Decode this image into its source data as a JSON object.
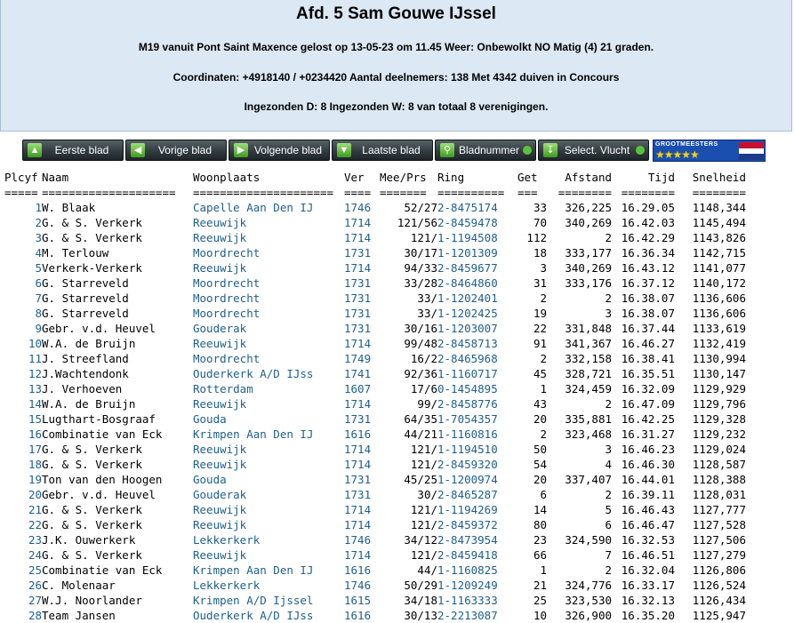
{
  "header": {
    "title": "Afd. 5 Sam Gouwe IJssel",
    "line1": "M19 vanuit Pont Saint Maxence gelost op 13-05-23 om 11.45 Weer: Onbewolkt NO Matig (4) 21 graden.",
    "line2": "Coordinaten: +4918140 / +0234420 Aantal deelnemers: 138 Met 4342 duiven in Concours",
    "line3": "Ingezonden D: 8 Ingezonden W: 8 van totaal 8 verenigingen."
  },
  "nav": {
    "first": "Eerste blad",
    "prev": "Vorige blad",
    "next": "Volgende blad",
    "last": "Laatste blad",
    "page": "Bladnummer",
    "select": "Select. Vlucht",
    "badge": "GROOTMEESTERS",
    "stars": "★★★★★",
    "icons": {
      "first": "up-arrow-icon",
      "prev": "left-arrow-icon",
      "next": "right-arrow-icon",
      "last": "down-arrow-icon",
      "page": "search-icon",
      "select": "download-icon"
    }
  },
  "table": {
    "headers": [
      "Plcyf",
      "Naam",
      "Woonplaats",
      "Ver",
      "Mee/Prs",
      "Ring",
      "Get",
      "Afstand",
      "Tijd",
      "Snelheid"
    ],
    "separators": [
      "=====",
      "====================",
      "=====================",
      "====",
      "=======",
      "==========",
      "===",
      "========",
      "========",
      "========"
    ],
    "rows": [
      [
        "1",
        "W. Blaak",
        "Capelle Aan Den IJ",
        "1746",
        "52/27",
        "2-8475174",
        "33",
        "326,225",
        "16.29.05",
        "1148,344"
      ],
      [
        "2",
        "G. & S. Verkerk",
        "Reeuwijk",
        "1714",
        "121/56",
        "2-8459478",
        "70",
        "340,269",
        "16.42.03",
        "1145,494"
      ],
      [
        "3",
        "G. & S. Verkerk",
        "Reeuwijk",
        "1714",
        "121/",
        "1-1194508",
        "112",
        "2",
        "16.42.29",
        "1143,826"
      ],
      [
        "4",
        "M. Terlouw",
        "Moordrecht",
        "1731",
        "30/17",
        "1-1201309",
        "18",
        "333,177",
        "16.36.34",
        "1142,715"
      ],
      [
        "5",
        "Verkerk-Verkerk",
        "Reeuwijk",
        "1714",
        "94/33",
        "2-8459677",
        "3",
        "340,269",
        "16.43.12",
        "1141,077"
      ],
      [
        "6",
        "G. Starreveld",
        "Moordrecht",
        "1731",
        "33/28",
        "2-8464860",
        "31",
        "333,176",
        "16.37.12",
        "1140,172"
      ],
      [
        "7",
        "G. Starreveld",
        "Moordrecht",
        "1731",
        "33/",
        "1-1202401",
        "2",
        "2",
        "16.38.07",
        "1136,606"
      ],
      [
        "8",
        "G. Starreveld",
        "Moordrecht",
        "1731",
        "33/",
        "1-1202425",
        "19",
        "3",
        "16.38.07",
        "1136,606"
      ],
      [
        "9",
        "Gebr. v.d. Heuvel",
        "Gouderak",
        "1731",
        "30/16",
        "1-1203007",
        "22",
        "331,848",
        "16.37.44",
        "1133,619"
      ],
      [
        "10",
        "W.A. de Bruijn",
        "Reeuwijk",
        "1714",
        "99/48",
        "2-8458713",
        "91",
        "341,367",
        "16.46.27",
        "1132,419"
      ],
      [
        "11",
        "J. Streefland",
        "Moordrecht",
        "1749",
        "16/2",
        "2-8465968",
        "2",
        "332,158",
        "16.38.41",
        "1130,994"
      ],
      [
        "12",
        "J.Wachtendonk",
        "Ouderkerk A/D IJss",
        "1741",
        "92/36",
        "1-1160717",
        "45",
        "328,721",
        "16.35.51",
        "1130,147"
      ],
      [
        "13",
        "J. Verhoeven",
        "Rotterdam",
        "1607",
        "17/6",
        "0-1454895",
        "1",
        "324,459",
        "16.32.09",
        "1129,929"
      ],
      [
        "14",
        "W.A. de Bruijn",
        "Reeuwijk",
        "1714",
        "99/",
        "2-8458776",
        "43",
        "2",
        "16.47.09",
        "1129,796"
      ],
      [
        "15",
        "Lugthart-Bosgraaf",
        "Gouda",
        "1731",
        "64/35",
        "1-7054357",
        "20",
        "335,881",
        "16.42.25",
        "1129,328"
      ],
      [
        "16",
        "Combinatie van Eck",
        "Krimpen Aan Den IJ",
        "1616",
        "44/21",
        "1-1160816",
        "2",
        "323,468",
        "16.31.27",
        "1129,232"
      ],
      [
        "17",
        "G. & S. Verkerk",
        "Reeuwijk",
        "1714",
        "121/",
        "1-1194510",
        "50",
        "3",
        "16.46.23",
        "1129,024"
      ],
      [
        "18",
        "G. & S. Verkerk",
        "Reeuwijk",
        "1714",
        "121/",
        "2-8459320",
        "54",
        "4",
        "16.46.30",
        "1128,587"
      ],
      [
        "19",
        "Ton van den Hoogen",
        "Gouda",
        "1731",
        "45/25",
        "1-1200974",
        "20",
        "337,407",
        "16.44.01",
        "1128,388"
      ],
      [
        "20",
        "Gebr. v.d. Heuvel",
        "Gouderak",
        "1731",
        "30/",
        "2-8465287",
        "6",
        "2",
        "16.39.11",
        "1128,031"
      ],
      [
        "21",
        "G. & S. Verkerk",
        "Reeuwijk",
        "1714",
        "121/",
        "1-1194269",
        "14",
        "5",
        "16.46.43",
        "1127,777"
      ],
      [
        "22",
        "G. & S. Verkerk",
        "Reeuwijk",
        "1714",
        "121/",
        "2-8459372",
        "80",
        "6",
        "16.46.47",
        "1127,528"
      ],
      [
        "23",
        "J.K. Ouwerkerk",
        "Lekkerkerk",
        "1746",
        "34/12",
        "2-8473954",
        "23",
        "324,590",
        "16.32.53",
        "1127,506"
      ],
      [
        "24",
        "G. & S. Verkerk",
        "Reeuwijk",
        "1714",
        "121/",
        "2-8459418",
        "66",
        "7",
        "16.46.51",
        "1127,279"
      ],
      [
        "25",
        "Combinatie van Eck",
        "Krimpen Aan Den IJ",
        "1616",
        "44/",
        "1-1160825",
        "1",
        "2",
        "16.32.04",
        "1126,806"
      ],
      [
        "26",
        "C. Molenaar",
        "Lekkerkerk",
        "1746",
        "50/29",
        "1-1209249",
        "21",
        "324,776",
        "16.33.17",
        "1126,524"
      ],
      [
        "27",
        "W.J. Noorlander",
        "Krimpen A/D Ijssel",
        "1615",
        "34/18",
        "1-1163333",
        "25",
        "323,530",
        "16.32.13",
        "1126,434"
      ],
      [
        "28",
        "Team Jansen",
        "Ouderkerk A/D IJss",
        "1616",
        "30/13",
        "2-2213087",
        "10",
        "326,900",
        "16.35.20",
        "1125,947"
      ]
    ]
  }
}
